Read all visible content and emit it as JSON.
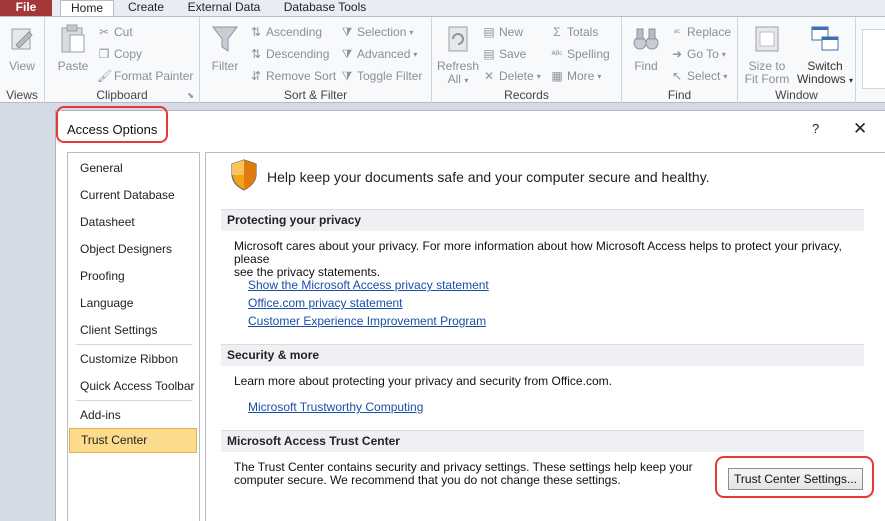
{
  "ribbon": {
    "tabs": {
      "file": "File",
      "home": "Home",
      "create": "Create",
      "external": "External Data",
      "dbtools": "Database Tools"
    },
    "views": {
      "view": "View",
      "label": "Views"
    },
    "clipboard": {
      "paste": "Paste",
      "cut": "Cut",
      "copy": "Copy",
      "format_painter": "Format Painter",
      "label": "Clipboard"
    },
    "sortfilter": {
      "filter": "Filter",
      "ascending": "Ascending",
      "descending": "Descending",
      "remove_sort": "Remove Sort",
      "selection": "Selection",
      "advanced": "Advanced",
      "toggle_filter": "Toggle Filter",
      "label": "Sort & Filter"
    },
    "records": {
      "refresh_1": "Refresh",
      "refresh_2": "All",
      "new": "New",
      "save": "Save",
      "delete": "Delete",
      "totals": "Totals",
      "spelling": "Spelling",
      "more": "More",
      "label": "Records"
    },
    "find": {
      "find": "Find",
      "replace": "Replace",
      "goto": "Go To",
      "select": "Select",
      "label": "Find"
    },
    "window": {
      "size_1": "Size to",
      "size_2": "Fit Form",
      "switch_1": "Switch",
      "switch_2": "Windows",
      "label": "Window"
    }
  },
  "dialog": {
    "title": "Access Options",
    "help": "?",
    "close": "✕",
    "nav": [
      "General",
      "Current Database",
      "Datasheet",
      "Object Designers",
      "Proofing",
      "Language",
      "Client Settings",
      "Customize Ribbon",
      "Quick Access Toolbar",
      "Add-ins",
      "Trust Center"
    ],
    "selected_nav": "Trust Center",
    "header": "Help keep your documents safe and your computer secure and healthy.",
    "privacy": {
      "title": "Protecting your privacy",
      "text_1": "Microsoft cares about your privacy. For more information about how Microsoft Access helps to protect your privacy, please",
      "text_2": "see the privacy statements.",
      "links": [
        "Show the Microsoft Access privacy statement",
        "Office.com privacy statement",
        "Customer Experience Improvement Program"
      ]
    },
    "security": {
      "title": "Security & more",
      "text": "Learn more about protecting your privacy and security from Office.com.",
      "link": "Microsoft Trustworthy Computing"
    },
    "trust_center": {
      "title": "Microsoft Access Trust Center",
      "text_1": "The Trust Center contains security and privacy settings. These settings help keep your",
      "text_2": "computer secure. We recommend that you do not change these settings.",
      "button": "Trust Center Settings..."
    }
  },
  "colors": {
    "file_tab": "#a4373a",
    "selected_nav": "#fcdb8c",
    "link": "#1a4fa8",
    "highlight": "#e53935"
  }
}
